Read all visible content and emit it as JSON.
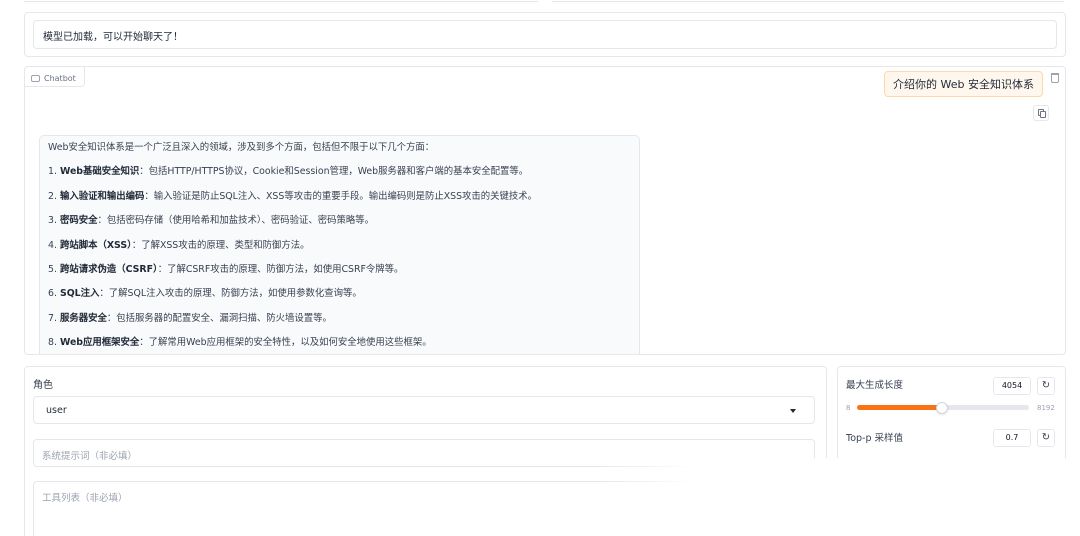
{
  "status": {
    "text": "模型已加载，可以开始聊天了！"
  },
  "chatbot": {
    "label": "Chatbot",
    "user_message": "介绍你的 Web 安全知识体系",
    "bot_intro": "Web安全知识体系是一个广泛且深入的领域，涉及到多个方面，包括但不限于以下几个方面：",
    "items": [
      {
        "num": "1.",
        "title": "Web基础安全知识",
        "desc": "：包括HTTP/HTTPS协议，Cookie和Session管理，Web服务器和客户端的基本安全配置等。"
      },
      {
        "num": "2.",
        "title": "输入验证和输出编码",
        "desc": "：输入验证是防止SQL注入、XSS等攻击的重要手段。输出编码则是防止XSS攻击的关键技术。"
      },
      {
        "num": "3.",
        "title": "密码安全",
        "desc": "：包括密码存储（使用哈希和加盐技术）、密码验证、密码策略等。"
      },
      {
        "num": "4.",
        "title": "跨站脚本（XSS）",
        "desc": "：了解XSS攻击的原理、类型和防御方法。"
      },
      {
        "num": "5.",
        "title": "跨站请求伪造（CSRF）",
        "desc": "：了解CSRF攻击的原理、防御方法，如使用CSRF令牌等。"
      },
      {
        "num": "6.",
        "title": "SQL注入",
        "desc": "：了解SQL注入攻击的原理、防御方法，如使用参数化查询等。"
      },
      {
        "num": "7.",
        "title": "服务器安全",
        "desc": "：包括服务器的配置安全、漏洞扫描、防火墙设置等。"
      },
      {
        "num": "8.",
        "title": "Web应用框架安全",
        "desc": "：了解常用Web应用框架的安全特性，以及如何安全地使用这些框架。"
      }
    ]
  },
  "form": {
    "role_label": "角色",
    "role_value": "user",
    "system_prompt_placeholder": "系统提示词（非必填）",
    "tools_placeholder": "工具列表（非必填）"
  },
  "settings": {
    "max_length": {
      "label": "最大生成长度",
      "value": "4054",
      "min": "8",
      "max": "8192",
      "fraction": 0.494
    },
    "top_p": {
      "label": "Top-p 采样值",
      "value": "0.7"
    }
  },
  "icons": {
    "reset": "↻"
  },
  "colors": {
    "accent": "#f97316",
    "user_bubble": "#fff7ed"
  }
}
